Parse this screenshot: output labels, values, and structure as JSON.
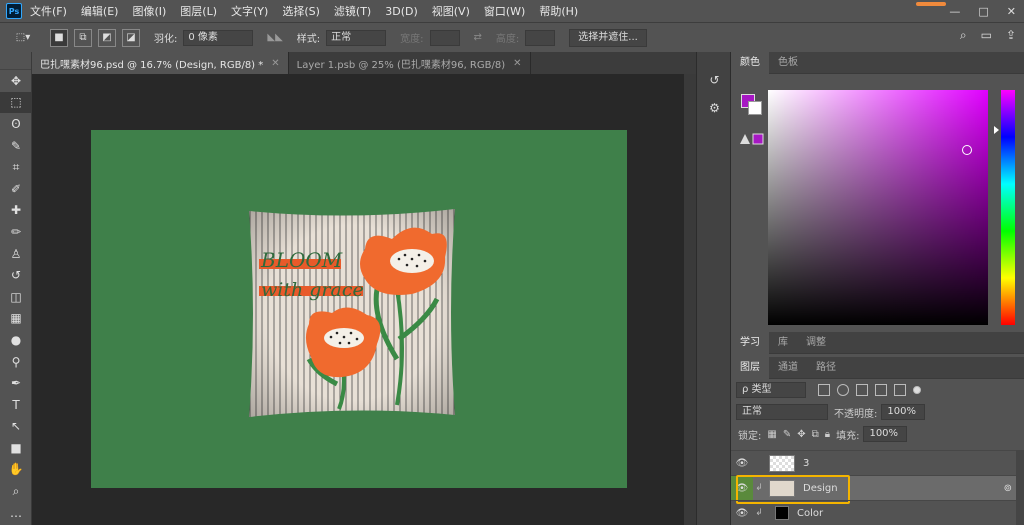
{
  "menubar": {
    "logo": "Ps",
    "items": [
      "文件(F)",
      "编辑(E)",
      "图像(I)",
      "图层(L)",
      "文字(Y)",
      "选择(S)",
      "滤镜(T)",
      "3D(D)",
      "视图(V)",
      "窗口(W)",
      "帮助(H)"
    ],
    "window_controls": [
      "—",
      "□",
      "✕"
    ]
  },
  "options": {
    "feather_label": "羽化:",
    "feather_value": "0 像素",
    "style_label": "样式:",
    "style_value": "正常",
    "width_label": "宽度:",
    "height_label": "高度:",
    "select_mask_button": "选择并遮住..."
  },
  "tabs": [
    {
      "label": "巴扎嘿素材96.psd @ 16.7% (Design, RGB/8) *",
      "active": true
    },
    {
      "label": "Layer 1.psb @ 25% (巴扎嘿素材96, RGB/8)",
      "active": false
    }
  ],
  "tools": [
    "move-icon",
    "marquee-icon",
    "lasso-icon",
    "quick-select-icon",
    "crop-icon",
    "eyedropper-icon",
    "healing-icon",
    "brush-icon",
    "stamp-icon",
    "history-brush-icon",
    "eraser-icon",
    "gradient-icon",
    "blur-icon",
    "dodge-icon",
    "pen-icon",
    "type-icon",
    "path-select-icon",
    "shape-icon",
    "hand-icon",
    "zoom-icon",
    "more-icon"
  ],
  "tool_glyphs": [
    "✥",
    "⬚",
    "ʘ",
    "✎",
    "⌗",
    "✐",
    "✚",
    "✏",
    "♙",
    "↺",
    "◫",
    "▦",
    "●",
    "⚲",
    "✒",
    "T",
    "↖",
    "■",
    "✋",
    "⌕",
    "…"
  ],
  "pillow_text": {
    "line1": "BLOOM",
    "line2": "with grace"
  },
  "color_panel": {
    "tabs": [
      "颜色",
      "色板"
    ],
    "foreground": "#a718c4",
    "background": "#ffffff"
  },
  "learn_tabs": [
    "学习",
    "库",
    "调整"
  ],
  "layers_panel": {
    "tabs": [
      "图层",
      "通道",
      "路径"
    ],
    "filter_label": "ρ 类型",
    "blend_mode": "正常",
    "opacity_label": "不透明度:",
    "opacity_value": "100%",
    "lock_label": "锁定:",
    "fill_label": "填充:",
    "fill_value": "100%",
    "layers": [
      {
        "name": "3",
        "selected": false
      },
      {
        "name": "Design",
        "selected": true
      },
      {
        "name": "Color",
        "selected": false
      }
    ]
  }
}
